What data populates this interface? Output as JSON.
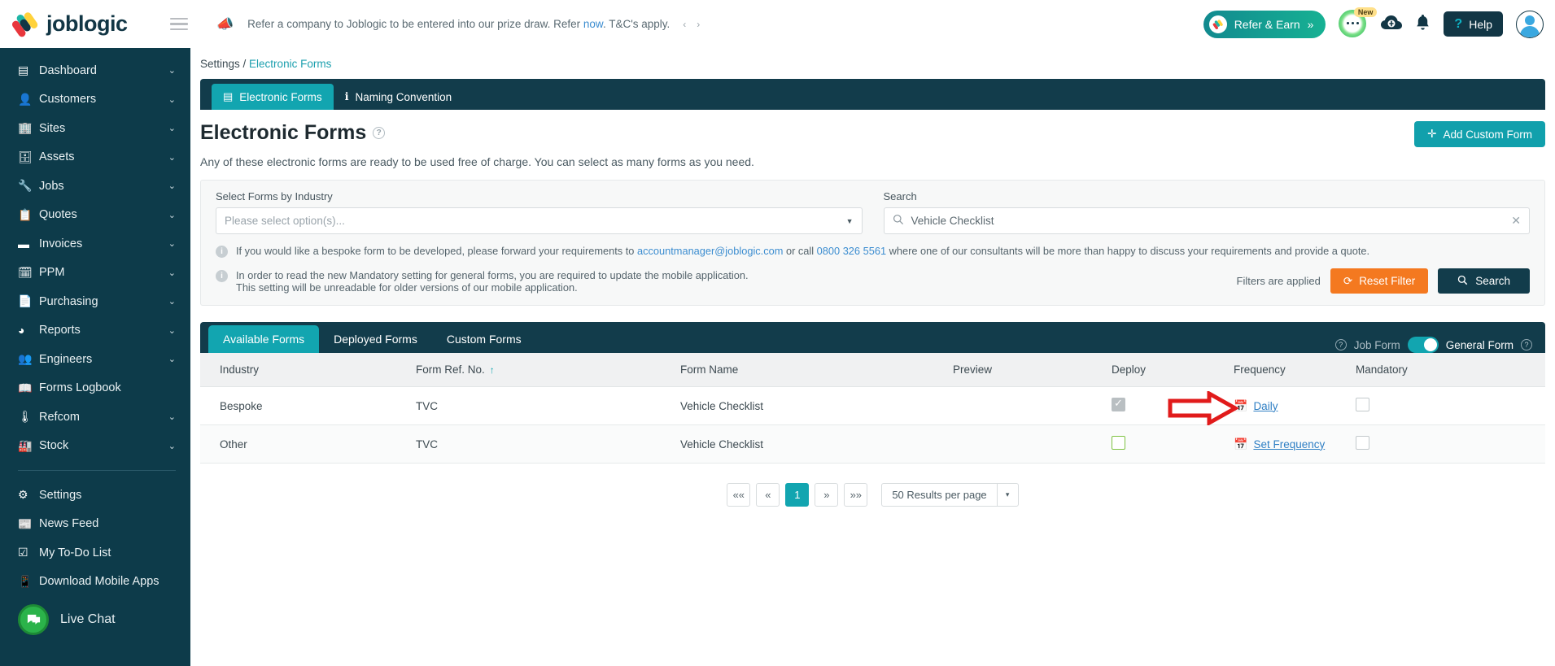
{
  "brand": {
    "name": "joblogic",
    "accent": "#12a5b0",
    "dark": "#0d3b4a",
    "orange": "#f47920"
  },
  "topbar": {
    "banner_text_1": "Refer a company to Joblogic to be entered into our prize draw. Refer ",
    "banner_link": "now",
    "banner_text_2": ". T&C's apply.",
    "refer_label": "Refer & Earn",
    "refer_chevrons": "»",
    "new_badge": "New",
    "help_label": "Help",
    "help_q": "?",
    "prev_arrow": "‹",
    "next_arrow": "›"
  },
  "sidebar": {
    "items": [
      {
        "label": "Dashboard",
        "icon": "dashboard-icon",
        "glyph": "▤",
        "chevron": true
      },
      {
        "label": "Customers",
        "icon": "user-icon",
        "glyph": "👤",
        "chevron": true
      },
      {
        "label": "Sites",
        "icon": "building-icon",
        "glyph": "🏢",
        "chevron": true
      },
      {
        "label": "Assets",
        "icon": "asset-icon",
        "glyph": "🗄",
        "chevron": true
      },
      {
        "label": "Jobs",
        "icon": "wrench-icon",
        "glyph": "🔧",
        "chevron": true
      },
      {
        "label": "Quotes",
        "icon": "clipboard-icon",
        "glyph": "📋",
        "chevron": true
      },
      {
        "label": "Invoices",
        "icon": "invoice-icon",
        "glyph": "▬",
        "chevron": true
      },
      {
        "label": "PPM",
        "icon": "calendar-check-icon",
        "glyph": "🗓",
        "chevron": true
      },
      {
        "label": "Purchasing",
        "icon": "document-icon",
        "glyph": "📄",
        "chevron": true
      },
      {
        "label": "Reports",
        "icon": "pie-chart-icon",
        "glyph": "◕",
        "chevron": true
      },
      {
        "label": "Engineers",
        "icon": "users-icon",
        "glyph": "👥",
        "chevron": true
      },
      {
        "label": "Forms Logbook",
        "icon": "book-icon",
        "glyph": "📖",
        "chevron": false
      },
      {
        "label": "Refcom",
        "icon": "cylinder-icon",
        "glyph": "🌡",
        "chevron": true
      },
      {
        "label": "Stock",
        "icon": "warehouse-icon",
        "glyph": "🏭",
        "chevron": true
      }
    ],
    "footer_items": [
      {
        "label": "Settings",
        "icon": "settings-user-icon",
        "glyph": "⚙"
      },
      {
        "label": "News Feed",
        "icon": "news-icon",
        "glyph": "📰"
      },
      {
        "label": "My To-Do List",
        "icon": "todo-icon",
        "glyph": "☑"
      },
      {
        "label": "Download Mobile Apps",
        "icon": "mobile-icon",
        "glyph": "📱"
      }
    ],
    "live_chat": "Live Chat"
  },
  "breadcrumb": {
    "root": "Settings",
    "sep": " / ",
    "current": "Electronic Forms"
  },
  "subtabs": [
    {
      "label": "Electronic Forms",
      "icon": "form-icon",
      "glyph": "▤",
      "active": true
    },
    {
      "label": "Naming Convention",
      "icon": "naming-icon",
      "glyph": "ℹ",
      "active": false
    }
  ],
  "page": {
    "title": "Electronic Forms",
    "help_glyph": "?",
    "subtitle": "Any of these electronic forms are ready to be used free of charge. You can select as many forms as you need.",
    "add_button": "Add Custom Form",
    "add_plus": "✛"
  },
  "filters": {
    "industry_label": "Select Forms by Industry",
    "industry_placeholder": "Please select option(s)...",
    "industry_value": "",
    "search_label": "Search",
    "search_value": "Vehicle Checklist",
    "search_placeholder": "Search",
    "clear_glyph": "✕",
    "notice1_a": "If you would like a bespoke form to be developed, please forward your requirements to ",
    "notice1_email": "accountmanager@joblogic.com",
    "notice1_b": " or call ",
    "notice1_phone": "0800 326 5561",
    "notice1_c": " where one of our consultants will be more than happy to discuss your requirements and provide a quote.",
    "notice2_line1": "In order to read the new Mandatory setting for general forms, you are required to update the mobile application.",
    "notice2_line2": "This setting will be unreadable for older versions of our mobile application.",
    "filters_applied": "Filters are applied",
    "reset_label": "Reset Filter",
    "reset_glyph": "⟳",
    "search_button": "Search",
    "search_btn_glyph": "🔍"
  },
  "tabs": [
    {
      "label": "Available Forms",
      "active": true
    },
    {
      "label": "Deployed Forms",
      "active": false
    },
    {
      "label": "Custom Forms",
      "active": false
    }
  ],
  "form_type_toggle": {
    "left_label": "Job Form",
    "right_label": "General Form",
    "state": "general",
    "help_glyph": "?"
  },
  "table": {
    "columns": [
      {
        "label": "Industry",
        "sorted": false
      },
      {
        "label": "Form Ref. No.",
        "sorted": true,
        "sort_glyph": "↑"
      },
      {
        "label": "Form Name",
        "sorted": false
      },
      {
        "label": "Preview",
        "sorted": false
      },
      {
        "label": "Deploy",
        "sorted": false
      },
      {
        "label": "Frequency",
        "sorted": false
      },
      {
        "label": "Mandatory",
        "sorted": false
      }
    ],
    "rows": [
      {
        "industry": "Bespoke",
        "form_ref": "TVC",
        "form_name": "Vehicle Checklist",
        "preview": "",
        "deploy_checked": true,
        "deploy_style": "grey-checked",
        "frequency_label": "Daily",
        "mandatory_checked": false
      },
      {
        "industry": "Other",
        "form_ref": "TVC",
        "form_name": "Vehicle Checklist",
        "preview": "",
        "deploy_checked": false,
        "deploy_style": "green-empty",
        "frequency_label": "Set Frequency",
        "mandatory_checked": false
      }
    ]
  },
  "pagination": {
    "first": "««",
    "prev": "«",
    "pages": [
      "1"
    ],
    "current": "1",
    "next": "»",
    "last": "»»",
    "per_page": "50 Results per page",
    "caret": "▾"
  }
}
